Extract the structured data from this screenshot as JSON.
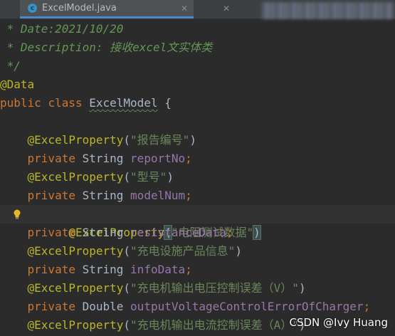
{
  "tab": {
    "icon": "java-class-icon",
    "icon_letter": "c",
    "title": "ExcelModel.java",
    "close_glyph": "✕"
  },
  "code": {
    "comment_date": " * Date:2021/10/20",
    "comment_desc": " * Description: 接收excel文实体类",
    "comment_end": " */",
    "annotation_data": "@Data",
    "kw_public": "public",
    "kw_class": "class",
    "class_name": "ExcelModel",
    "open_brace": "{",
    "annotation_excel": "@ExcelProperty",
    "kw_private": "private",
    "props": [
      {
        "label": "\"报告编号\"",
        "type": "String",
        "field": "reportNo"
      },
      {
        "label": "\"型号\"",
        "type": "String",
        "field": "modelNum"
      },
      {
        "label": "\"电阻测试数据\"",
        "type": "String",
        "field": "resistanceData"
      },
      {
        "label": "\"充电设施产品信息\"",
        "type": "String",
        "field": "infoData"
      },
      {
        "label": "\"充电机输出电压控制误差（V）\"",
        "type": "Double",
        "field": "outputVoltageControlErrorOfCharger"
      },
      {
        "label": "\"充电机输出电流控制误差（A）\""
      }
    ]
  },
  "watermark": "CSDN @Ivy Huang"
}
